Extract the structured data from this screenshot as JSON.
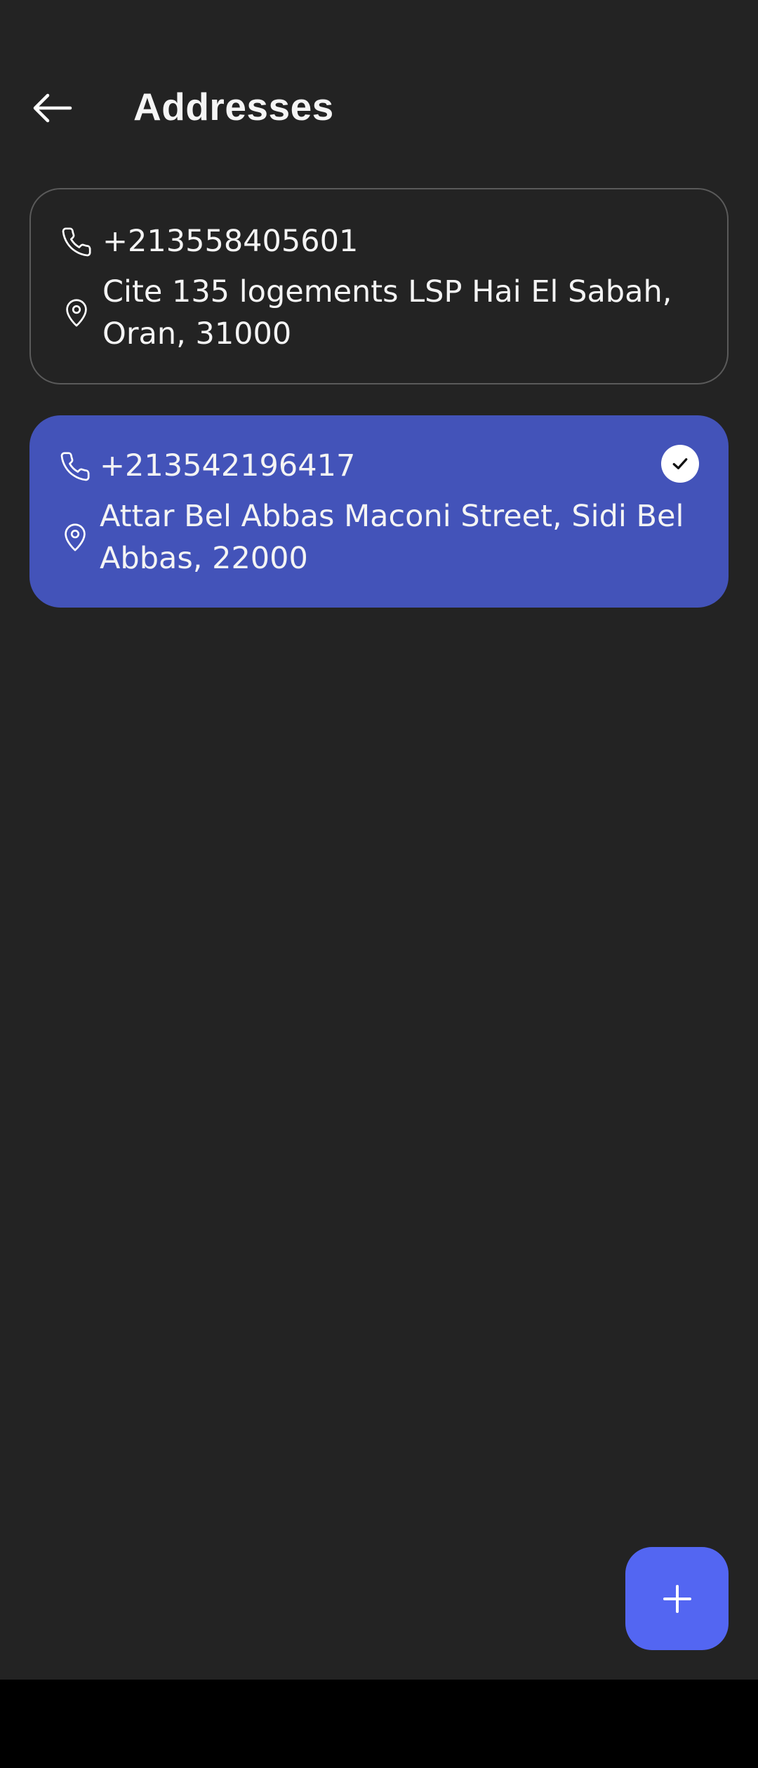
{
  "header": {
    "title": "Addresses",
    "back_icon": "arrow-left-icon"
  },
  "addresses": [
    {
      "phone": "+213558405601",
      "address_line1": "Cite 135 logements LSP Hai El Sabah,",
      "address_line2": "Oran, 31000",
      "selected": false
    },
    {
      "phone": "+213542196417",
      "address_line1": "Attar Bel Abbas Maconi Street, Sidi Bel",
      "address_line2": "Abbas, 22000",
      "selected": true
    }
  ],
  "fab": {
    "icon": "plus-icon"
  },
  "colors": {
    "background": "#232323",
    "card_border": "#5a5a5a",
    "selected_card": "#4353b9",
    "fab": "#5366f2",
    "text": "#ffffff"
  }
}
